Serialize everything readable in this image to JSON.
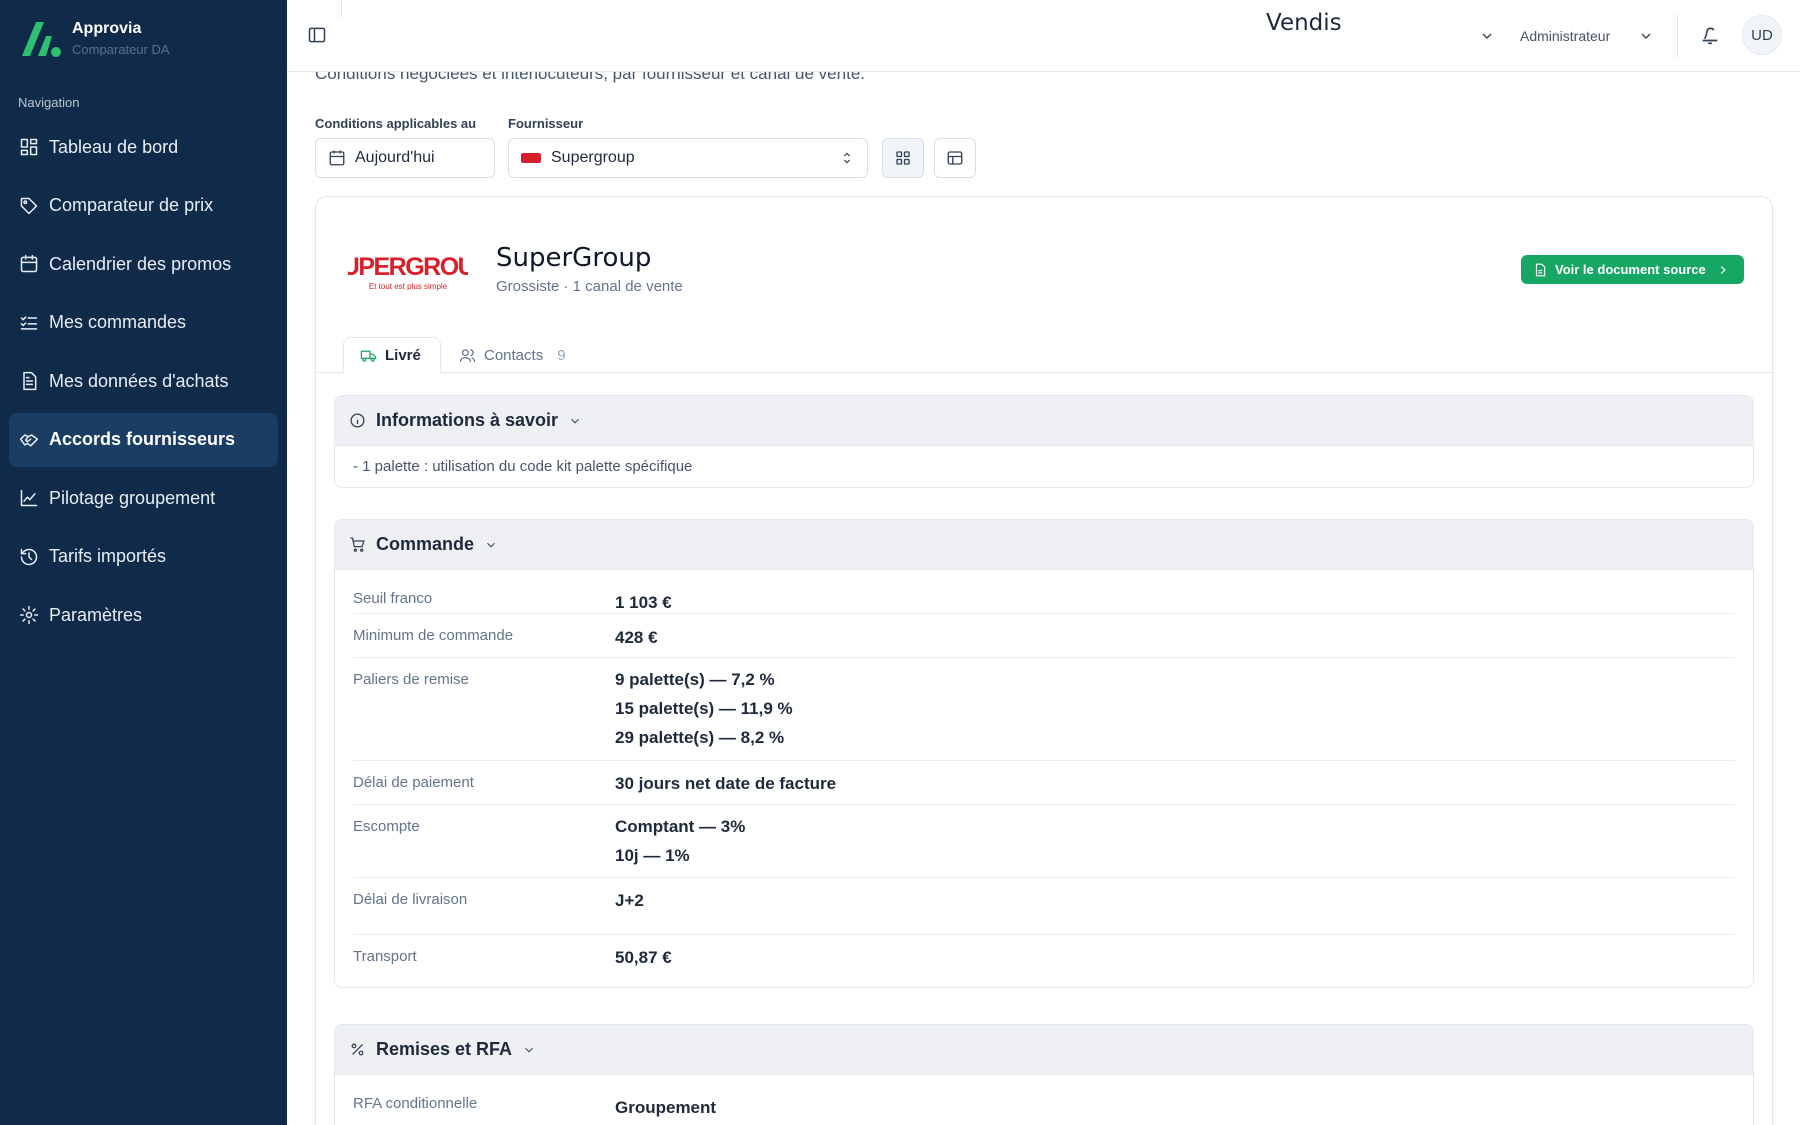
{
  "brand": {
    "name": "Approvia",
    "subtitle": "Comparateur DA"
  },
  "sidebar": {
    "nav_title": "Navigation",
    "items": [
      {
        "label": "Tableau de bord",
        "icon": "dashboard-icon"
      },
      {
        "label": "Comparateur de prix",
        "icon": "tag-icon"
      },
      {
        "label": "Calendrier des promos",
        "icon": "calendar-icon"
      },
      {
        "label": "Mes commandes",
        "icon": "checklist-icon"
      },
      {
        "label": "Mes données d'achats",
        "icon": "document-icon"
      },
      {
        "label": "Accords fournisseurs",
        "icon": "handshake-icon",
        "active": true
      },
      {
        "label": "Pilotage groupement",
        "icon": "line-chart-icon"
      },
      {
        "label": "Tarifs importés",
        "icon": "history-icon"
      },
      {
        "label": "Paramètres",
        "icon": "gear-icon"
      }
    ]
  },
  "topbar": {
    "organization": "Vendis",
    "role": "Administrateur",
    "avatar_initials": "UD"
  },
  "page": {
    "subtitle": "Conditions négociées et interlocuteurs, par fournisseur et canal de vente.",
    "filters": {
      "date_label": "Conditions applicables au",
      "date_value": "Aujourd'hui",
      "supplier_label": "Fournisseur",
      "supplier_value": "Supergroup"
    }
  },
  "supplier": {
    "name": "SuperGroup",
    "logo_text": "SUPERGROUP",
    "logo_tagline": "Et tout est plus simple",
    "meta": "Grossiste · 1 canal de vente",
    "source_button": "Voir le document source",
    "tabs": [
      {
        "label": "Livré"
      },
      {
        "label": "Contacts",
        "count": "9"
      }
    ]
  },
  "sections": {
    "info": {
      "title": "Informations à savoir",
      "text": "- 1 palette : utilisation du code kit palette spécifique"
    },
    "commande": {
      "title": "Commande",
      "rows": [
        {
          "label": "Seuil franco",
          "values": [
            "1 103 €"
          ]
        },
        {
          "label": "Minimum de commande",
          "values": [
            "428 €"
          ]
        },
        {
          "label": "Paliers de remise",
          "values": [
            "9 palette(s)  —  7,2 %",
            "15 palette(s)  —  11,9 %",
            "29 palette(s)  —  8,2 %"
          ]
        },
        {
          "label": "Délai de paiement",
          "values": [
            "30 jours net date de facture"
          ]
        },
        {
          "label": "Escompte",
          "values": [
            "Comptant  —  3%",
            "10j  —  1%"
          ]
        },
        {
          "label": "Délai de livraison",
          "values": [
            "J+2"
          ]
        },
        {
          "label": "Transport",
          "values": [
            "50,87 €"
          ]
        }
      ]
    },
    "remises": {
      "title": "Remises et RFA",
      "rows": [
        {
          "label": "RFA conditionnelle",
          "values": [
            "Groupement"
          ]
        }
      ]
    }
  },
  "colors": {
    "sidebar": "#102a4a",
    "active": "#1c3d63",
    "accent": "#16a765",
    "brand_red": "#d6202b"
  }
}
